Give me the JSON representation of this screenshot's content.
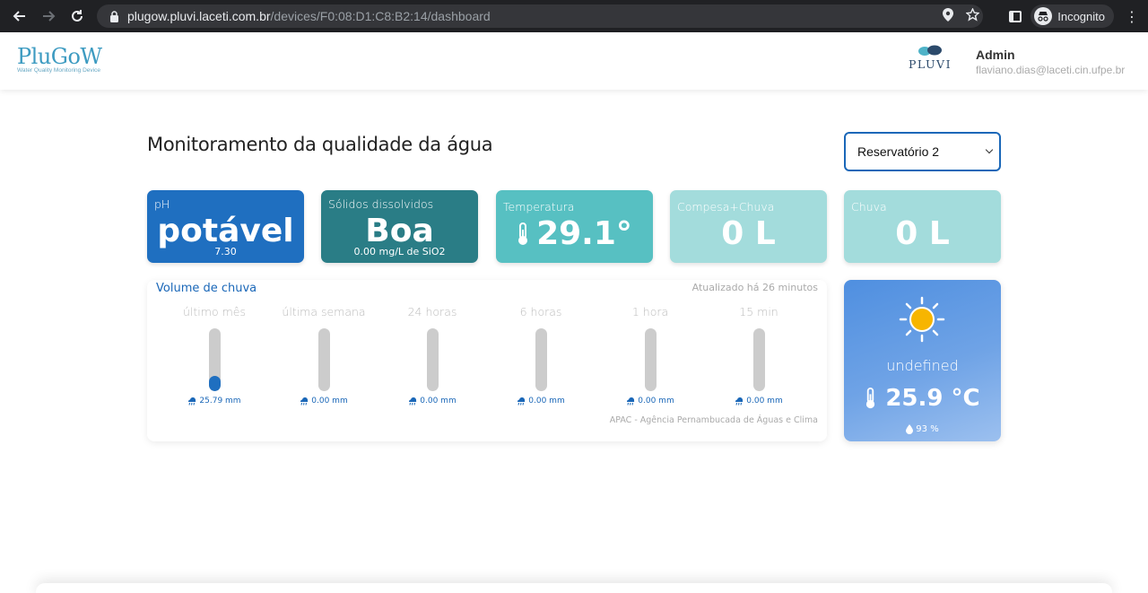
{
  "browser": {
    "url_host": "plugow.pluvi.laceti.com.br",
    "url_path": "/devices/F0:08:D1:C8:B2:14/dashboard",
    "incognito_label": "Incognito"
  },
  "header": {
    "logo_title": "PluGoW",
    "logo_subtitle": "Water Quality Monitoring Device",
    "partner_logo": "PLUVI",
    "user_name": "Admin",
    "user_email": "flaviano.dias@laceti.cin.ufpe.br"
  },
  "main": {
    "title": "Monitoramento da qualidade da água",
    "reservoir_selected": "Reservatório 2"
  },
  "cards": {
    "ph": {
      "label": "pH",
      "value": "potável",
      "sub": "7.30",
      "color": "#1f6fc0"
    },
    "solids": {
      "label": "Sólidos dissolvidos",
      "value": "Boa",
      "sub": "0.00 mg/L de SiO2",
      "color": "#2a7d86"
    },
    "temperature": {
      "label": "Temperatura",
      "value": "29.1°",
      "icon": "thermometer-icon",
      "color": "#57c0c2"
    },
    "compesa": {
      "label": "Compesa+Chuva",
      "value": "0 L",
      "color": "#a3dcdc"
    },
    "chuva": {
      "label": "Chuva",
      "value": "0 L",
      "color": "#a3dcdc"
    }
  },
  "rain_volume": {
    "title": "Volume de chuva",
    "updated": "Atualizado há 26 minutos",
    "source": "APAC - Agência Pernambucada de Águas e Clima",
    "periods": [
      {
        "label": "último mês",
        "value": "25.79 mm",
        "fill_fraction": 0.25
      },
      {
        "label": "última semana",
        "value": "0.00 mm",
        "fill_fraction": 0
      },
      {
        "label": "24 horas",
        "value": "0.00 mm",
        "fill_fraction": 0
      },
      {
        "label": "6 horas",
        "value": "0.00 mm",
        "fill_fraction": 0
      },
      {
        "label": "1 hora",
        "value": "0.00 mm",
        "fill_fraction": 0
      },
      {
        "label": "15 min",
        "value": "0.00 mm",
        "fill_fraction": 0
      }
    ]
  },
  "weather": {
    "condition": "undefined",
    "temperature": "25.9 °C",
    "humidity": "93 %",
    "icon": "sun-icon"
  }
}
